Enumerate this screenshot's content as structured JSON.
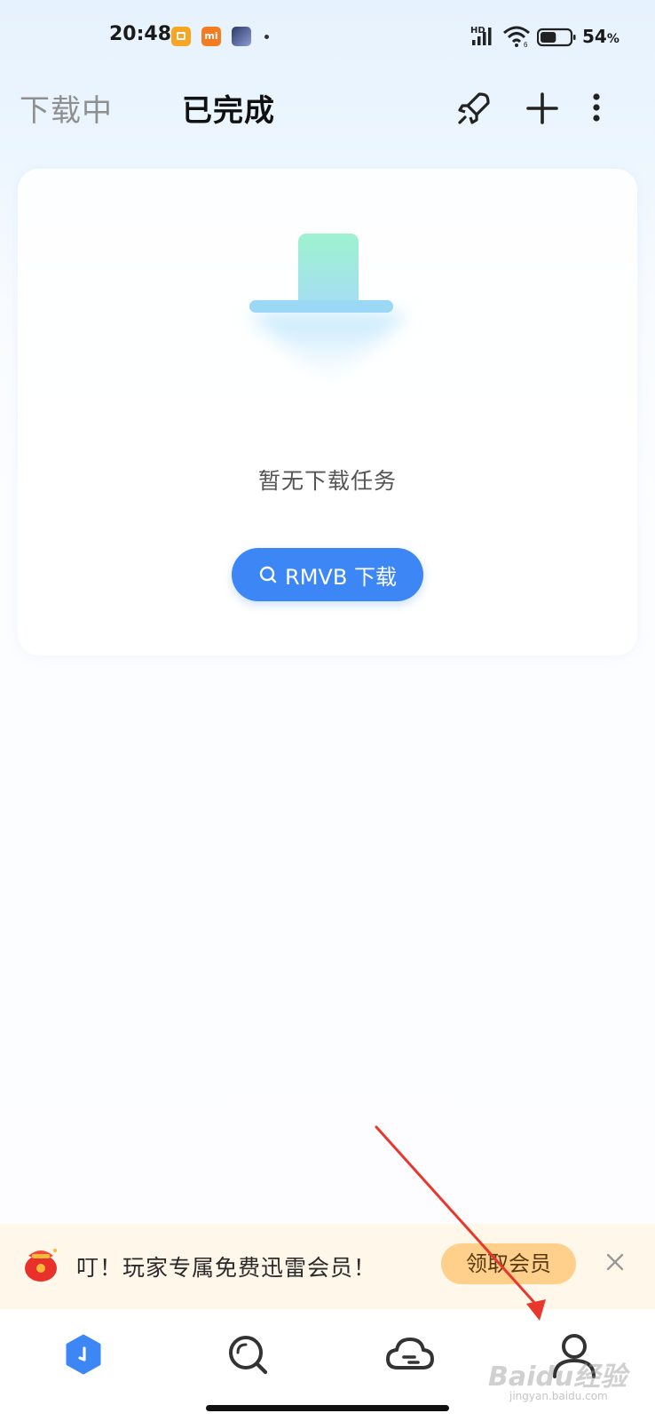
{
  "status_bar": {
    "time": "20:48",
    "notification_icons": [
      "note-icon",
      "mi-icon",
      "game-icon"
    ],
    "mi_label": "mi",
    "signal_label": "HD",
    "wifi_label": "6",
    "battery_level": 0.54,
    "battery_text": "54",
    "battery_unit": "%"
  },
  "header": {
    "tabs": [
      {
        "label": "下载中",
        "active": false
      },
      {
        "label": "已完成",
        "active": true
      }
    ],
    "actions": [
      "rocket-icon",
      "plus-icon",
      "more-icon"
    ]
  },
  "main": {
    "empty_text": "暂无下载任务",
    "search_button_label": "RMVB 下载"
  },
  "promo": {
    "text": "叮！玩家专属免费迅雷会员！",
    "button_label": "领取会员"
  },
  "bottom_nav": {
    "items": [
      {
        "icon": "download-icon",
        "active": true
      },
      {
        "icon": "discover-icon",
        "active": false
      },
      {
        "icon": "cloud-icon",
        "active": false
      },
      {
        "icon": "profile-icon",
        "active": false
      }
    ]
  },
  "watermark": {
    "text": "Baidu经验",
    "url_text": "jingyan.baidu.com"
  },
  "colors": {
    "accent": "#3d86f5",
    "promo_bg": "#fff7e9",
    "promo_button": "#ffd08c",
    "annotation_arrow": "#e8372c"
  }
}
